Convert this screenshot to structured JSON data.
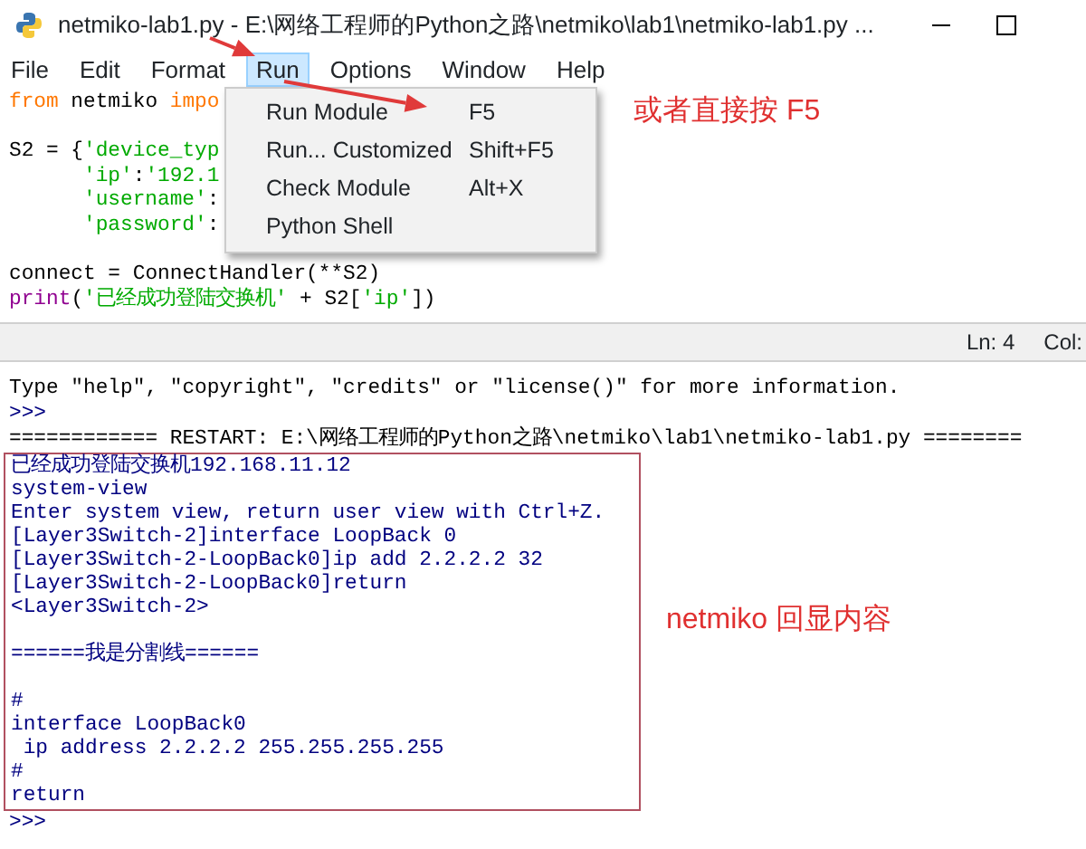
{
  "window": {
    "title": "netmiko-lab1.py - E:\\网络工程师的Python之路\\netmiko\\lab1\\netmiko-lab1.py ..."
  },
  "menu": [
    {
      "label": "File",
      "selected": false
    },
    {
      "label": "Edit",
      "selected": false
    },
    {
      "label": "Format",
      "selected": false
    },
    {
      "label": "Run",
      "selected": true
    },
    {
      "label": "Options",
      "selected": false
    },
    {
      "label": "Window",
      "selected": false
    },
    {
      "label": "Help",
      "selected": false
    }
  ],
  "editor": {
    "lines": [
      {
        "tokens": [
          {
            "text": "from",
            "kind": "keyword"
          },
          {
            "text": " netmiko ",
            "kind": "plain"
          },
          {
            "text": "impo",
            "kind": "keyword"
          }
        ]
      },
      {
        "kind": "blank"
      },
      {
        "tokens": [
          {
            "text": "S2 = {",
            "kind": "plain"
          },
          {
            "text": "'device_typ",
            "kind": "string"
          }
        ]
      },
      {
        "continuation": true,
        "tokens": [
          {
            "text": "'ip'",
            "kind": "string"
          },
          {
            "text": ":",
            "kind": "plain"
          },
          {
            "text": "'192.1",
            "kind": "string"
          }
        ]
      },
      {
        "continuation": true,
        "tokens": [
          {
            "text": "'username'",
            "kind": "string"
          },
          {
            "text": ":",
            "kind": "plain"
          }
        ]
      },
      {
        "continuation": true,
        "tokens": [
          {
            "text": "'password'",
            "kind": "string"
          },
          {
            "text": ":",
            "kind": "plain"
          }
        ]
      },
      {
        "kind": "blank"
      },
      {
        "tokens": [
          {
            "text": "connect = ConnectHandler(**S2)",
            "kind": "plain"
          }
        ]
      },
      {
        "tokens": [
          {
            "text": "print",
            "kind": "builtin"
          },
          {
            "text": "(",
            "kind": "plain"
          },
          {
            "text": "'已经成功登陆交换机'",
            "kind": "string"
          },
          {
            "text": " + S2[",
            "kind": "plain"
          },
          {
            "text": "'ip'",
            "kind": "string"
          },
          {
            "text": "])",
            "kind": "plain"
          }
        ]
      }
    ]
  },
  "run_menu": [
    {
      "label": "Run Module",
      "shortcut": "F5"
    },
    {
      "label": "Run... Customized",
      "shortcut": "Shift+F5"
    },
    {
      "label": "Check Module",
      "shortcut": "Alt+X"
    },
    {
      "label": "Python Shell"
    }
  ],
  "status_bar": {
    "line": "Ln: 4",
    "column": "Col:"
  },
  "shell": {
    "intro": [
      {
        "text": "Type \"help\", \"copyright\", \"credits\" or \"license()\" for more information.",
        "kind": "info"
      },
      {
        "text": ">>>",
        "kind": "prompt"
      },
      {
        "text": "============ RESTART: E:\\网络工程师的Python之路\\netmiko\\lab1\\netmiko-lab1.py ========",
        "kind": "info"
      }
    ],
    "output": [
      {
        "text": "已经成功登陆交换机192.168.11.12",
        "kind": "output"
      },
      {
        "text": "system-view",
        "kind": "output"
      },
      {
        "text": "Enter system view, return user view with Ctrl+Z.",
        "kind": "output"
      },
      {
        "text": "[Layer3Switch-2]interface LoopBack 0",
        "kind": "output"
      },
      {
        "text": "[Layer3Switch-2-LoopBack0]ip add 2.2.2.2 32",
        "kind": "output"
      },
      {
        "text": "[Layer3Switch-2-LoopBack0]return",
        "kind": "output"
      },
      {
        "text": "<Layer3Switch-2>",
        "kind": "output"
      },
      {
        "kind": "blank"
      },
      {
        "text": "======我是分割线======",
        "kind": "output"
      },
      {
        "kind": "blank"
      },
      {
        "text": "#",
        "kind": "output"
      },
      {
        "text": "interface LoopBack0",
        "kind": "output"
      },
      {
        "text": " ip address 2.2.2.2 255.255.255.255",
        "kind": "output"
      },
      {
        "text": "#",
        "kind": "output"
      },
      {
        "text": "return",
        "kind": "output"
      }
    ],
    "prompt": ">>>"
  },
  "annotations": [
    {
      "text": "或者直接按 F5"
    },
    {
      "text": "netmiko 回显内容"
    }
  ]
}
